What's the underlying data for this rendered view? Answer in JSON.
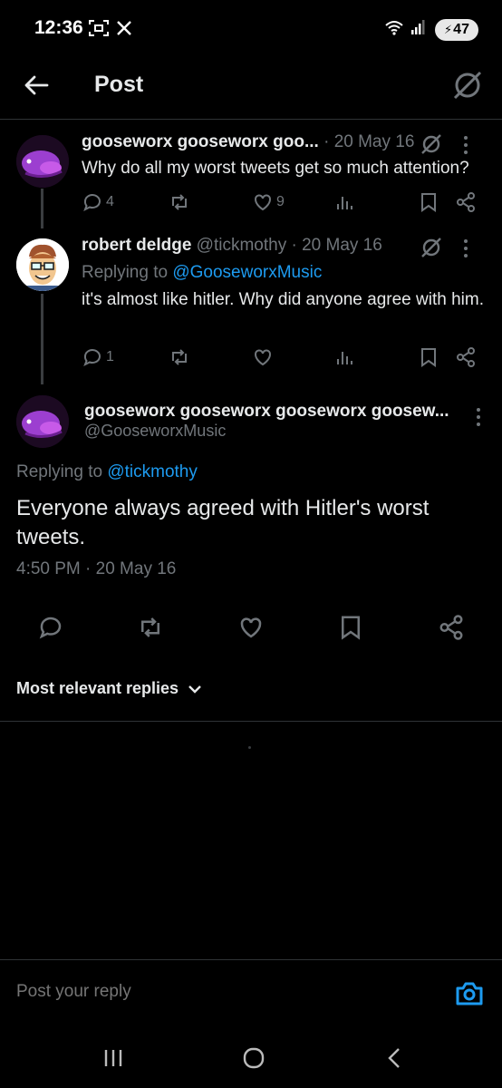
{
  "status_bar": {
    "time": "12:36",
    "battery": "47",
    "icons": [
      "screenshot-icon",
      "x-logo-icon",
      "wifi-icon",
      "signal-icon",
      "battery-icon"
    ]
  },
  "header": {
    "title": "Post",
    "back_icon": "arrow-left-icon",
    "grok_icon": "grok-icon"
  },
  "thread": [
    {
      "display_name": "gooseworx gooseworx goo...",
      "meta": " · 20 May 16",
      "text": "Why do all my worst tweets get so much attention?",
      "actions": {
        "replies": "4",
        "reposts": "",
        "likes": "9"
      }
    },
    {
      "display_name": "robert deldge",
      "meta": " @tickmothy · 20 May 16",
      "replying_prefix": "Replying to ",
      "replying_to": "@GooseworxMusic",
      "text": "it's almost like hitler. Why did anyone agree with him.",
      "actions": {
        "replies": "1",
        "reposts": "",
        "likes": ""
      }
    }
  ],
  "main_post": {
    "display_name": "gooseworx gooseworx gooseworx goosew...",
    "handle": "@GooseworxMusic",
    "replying_prefix": "Replying to ",
    "replying_to": "@tickmothy",
    "text": "Everyone always agreed with Hitler's worst tweets.",
    "timestamp": "4:50 PM · 20 May 16"
  },
  "replies_sort": {
    "label": "Most relevant replies"
  },
  "reply_bar": {
    "placeholder": "Post your reply"
  },
  "colors": {
    "background": "#000000",
    "text": "#e7e9ea",
    "muted": "#71767b",
    "link": "#1d9bf0",
    "divider": "#2f3336"
  }
}
